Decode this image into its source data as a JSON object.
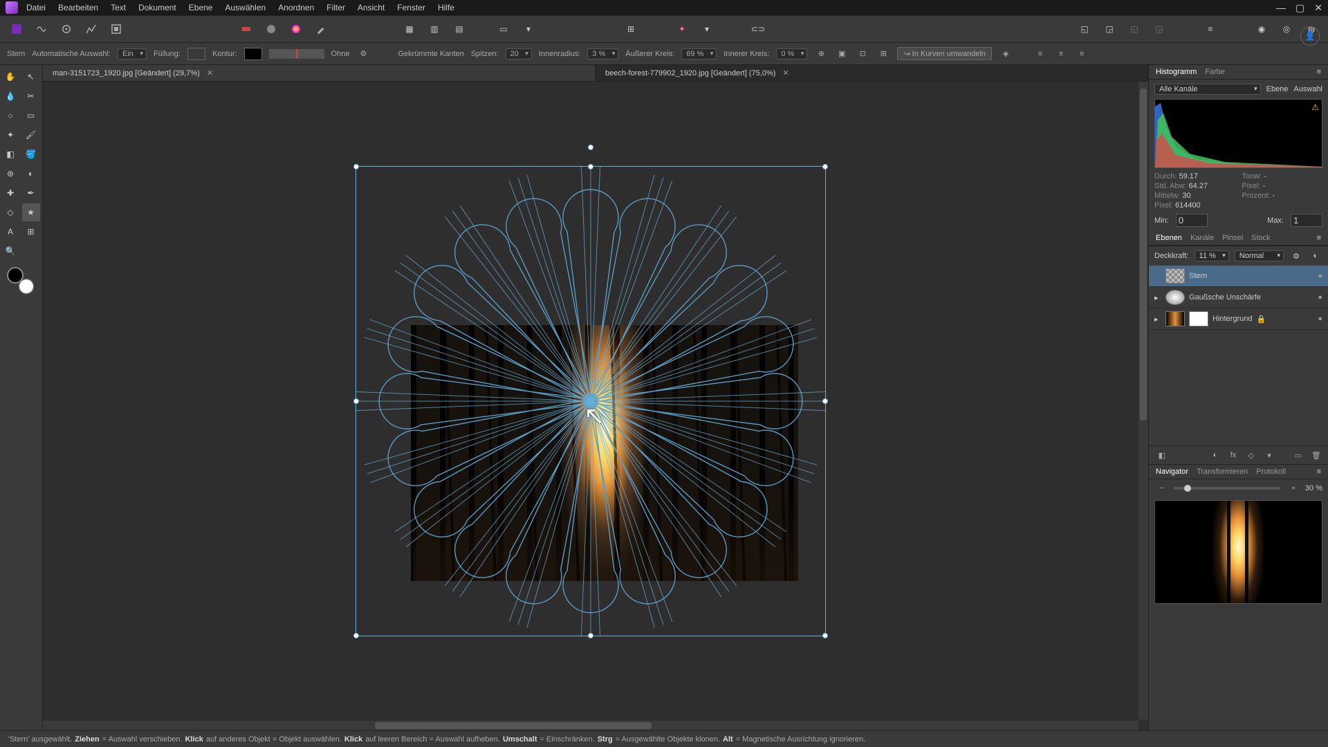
{
  "menu": [
    "Datei",
    "Bearbeiten",
    "Text",
    "Dokument",
    "Ebene",
    "Auswählen",
    "Anordnen",
    "Filter",
    "Ansicht",
    "Fenster",
    "Hilfe"
  ],
  "context": {
    "tool": "Stern",
    "autoselect_label": "Automatische Auswahl:",
    "autoselect_value": "Ein",
    "fill_label": "Füllung:",
    "fill_color": "#ffffff",
    "stroke_label": "Kontur:",
    "stroke_color": "#000000",
    "stroke_style": "Ohne",
    "antialias_label": "Gekrümmte Kanten",
    "points_label": "Spitzen:",
    "points": "20",
    "inner_radius_label": "Innenradius:",
    "inner_radius": "3 %",
    "outer_circle_label": "Äußerer Kreis:",
    "outer_circle": "69 %",
    "inner_circle_label": "Innerer Kreis:",
    "inner_circle": "0 %",
    "convert_label": "In Kurven umwandeln"
  },
  "tabs": [
    {
      "label": "man-3151723_1920.jpg [Geändert] (29,7%)",
      "active": false
    },
    {
      "label": "beech-forest-779902_1920.jpg [Geändert] (75,0%)",
      "active": true
    }
  ],
  "histogram": {
    "tabs": [
      "Histogramm",
      "Farbe"
    ],
    "channel": "Alle Kanäle",
    "sub_tabs": [
      "Ebene",
      "Auswahl"
    ],
    "stats": {
      "mean_label": "Durch:",
      "mean": "59.17",
      "std_label": "Std. Abw:",
      "std": "64.27",
      "median_label": "Mittelw:",
      "median": "30",
      "pixels_label": "Pixel:",
      "pixels": "614400",
      "tone_label": "Tonw:",
      "tone": "-",
      "pix_pct_label": "Pixel:",
      "pix_pct": "-",
      "percent_label": "Prozent:",
      "percent": "-"
    },
    "min_label": "Min:",
    "min": "0",
    "max_label": "Max:",
    "max": "1"
  },
  "layers": {
    "tabs": [
      "Ebenen",
      "Kanäle",
      "Pinsel",
      "Stock"
    ],
    "opacity_label": "Deckkraft:",
    "opacity": "11 %",
    "blend": "Normal",
    "items": [
      {
        "name": "Stern",
        "selected": true,
        "type": "shape"
      },
      {
        "name": "Gaußsche Unschärfe",
        "selected": false,
        "type": "filter"
      },
      {
        "name": "Hintergrund",
        "selected": false,
        "type": "pixel",
        "locked": true
      }
    ]
  },
  "navigator": {
    "tabs": [
      "Navigator",
      "Transformieren",
      "Protokoll"
    ],
    "zoom": "30 %"
  },
  "status": {
    "prefix": "'Stern' ausgewählt. ",
    "drag_k": "Ziehen",
    "drag_t": " = Auswahl verschieben. ",
    "click1_k": "Klick",
    "click1_t": " auf anderes Objekt = Objekt auswählen. ",
    "click2_k": "Klick",
    "click2_t": " auf leeren Bereich = Auswahl aufheben. ",
    "shift_k": "Umschalt",
    "shift_t": " = Einschränken. ",
    "ctrl_k": "Strg",
    "ctrl_t": " = Ausgewählte Objekte klonen. ",
    "alt_k": "Alt",
    "alt_t": " = Magnetische Ausrichtung ignorieren."
  }
}
